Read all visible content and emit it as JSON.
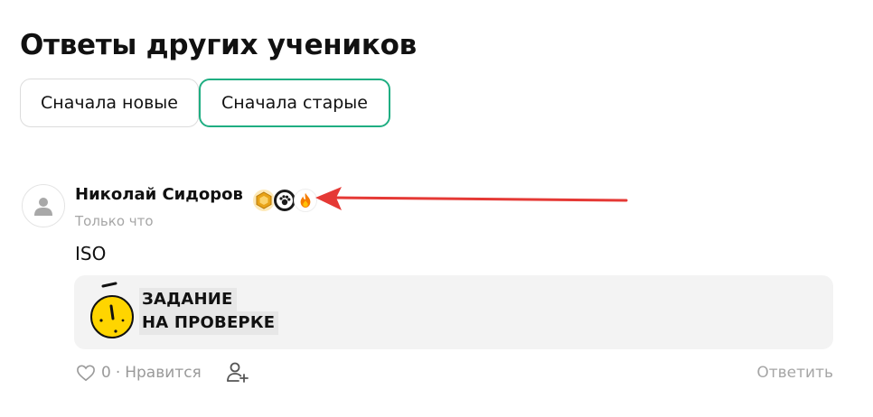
{
  "section": {
    "title": "Ответы других учеников"
  },
  "sort": {
    "newest_label": "Сначала новые",
    "oldest_label": "Сначала старые",
    "active": "oldest"
  },
  "answer": {
    "author": "Николай Сидоров",
    "timestamp": "Только что",
    "text": "ISO",
    "badges": [
      "hexagon-badge-icon",
      "paw-badge-icon",
      "fire-badge-icon"
    ],
    "status": {
      "line1": "ЗАДАНИЕ",
      "line2": "НА ПРОВЕРКЕ",
      "icon": "stopwatch-icon"
    },
    "likes": {
      "count": "0",
      "separator": "·",
      "label": "Нравится"
    },
    "reply_label": "Ответить"
  },
  "colors": {
    "accent": "#1fae82",
    "annotation_arrow": "#e53935",
    "card_bg": "#f3f3f3",
    "stopwatch": "#ffd500",
    "muted_text": "#a6a6a6"
  }
}
